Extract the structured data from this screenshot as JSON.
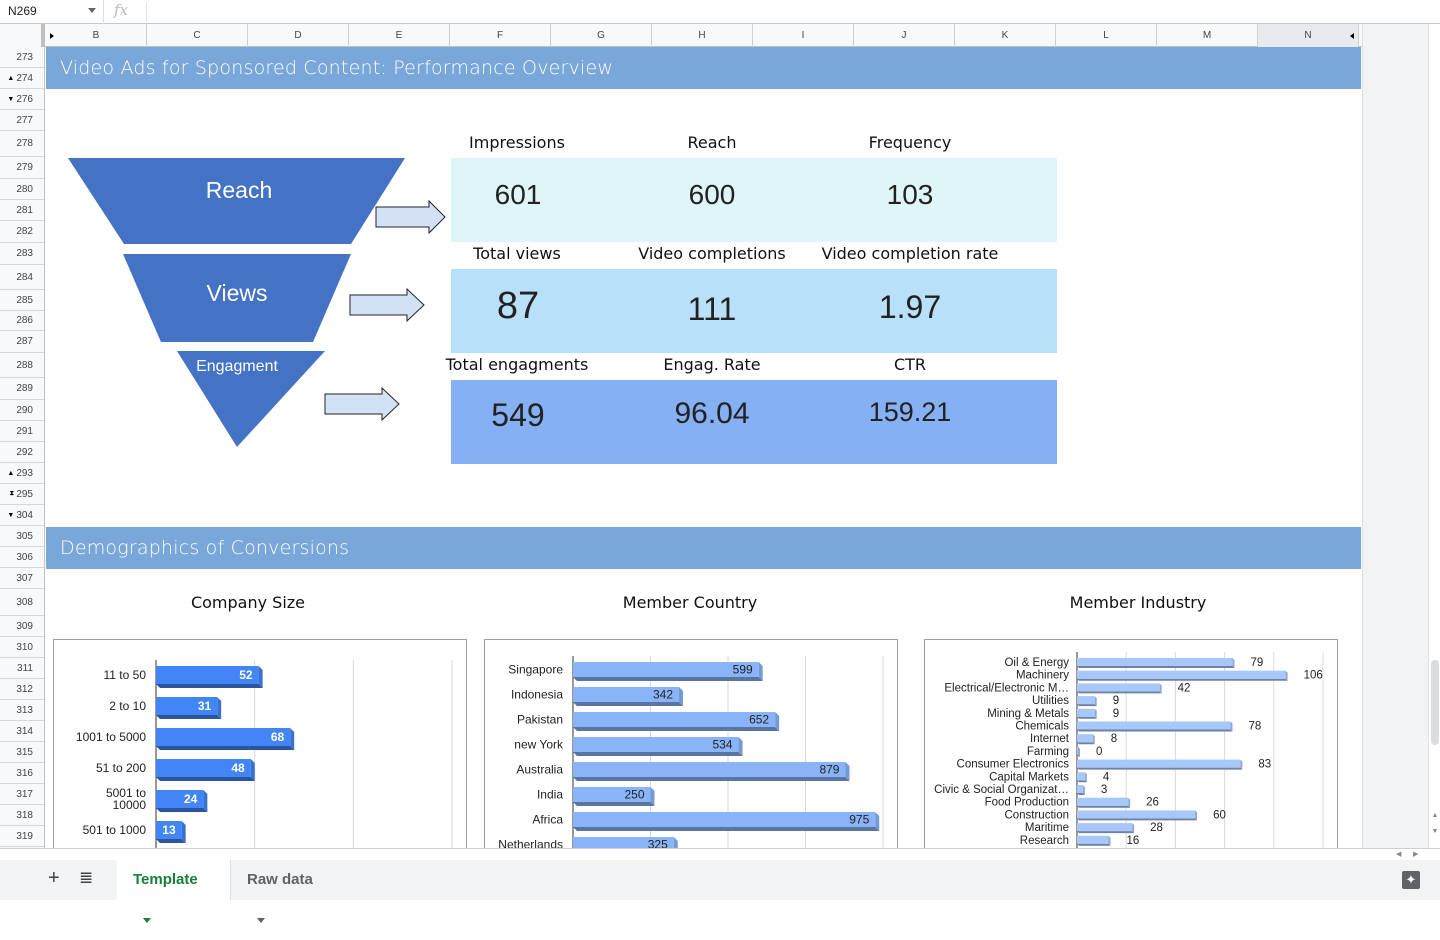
{
  "formula_bar": {
    "cell_ref": "N269",
    "fx_symbol": "fx",
    "formula": ""
  },
  "columns": [
    "B",
    "C",
    "D",
    "E",
    "F",
    "G",
    "H",
    "I",
    "J",
    "K",
    "L",
    "M",
    "N"
  ],
  "rows": [
    {
      "label": "273",
      "marker": ""
    },
    {
      "label": "274",
      "marker": "▲"
    },
    {
      "label": "276",
      "marker": "▼"
    },
    {
      "label": "277",
      "marker": ""
    },
    {
      "label": "278",
      "marker": ""
    },
    {
      "label": "279",
      "marker": ""
    },
    {
      "label": "280",
      "marker": ""
    },
    {
      "label": "281",
      "marker": ""
    },
    {
      "label": "282",
      "marker": ""
    },
    {
      "label": "283",
      "marker": ""
    },
    {
      "label": "284",
      "marker": ""
    },
    {
      "label": "285",
      "marker": ""
    },
    {
      "label": "286",
      "marker": ""
    },
    {
      "label": "287",
      "marker": ""
    },
    {
      "label": "288",
      "marker": ""
    },
    {
      "label": "289",
      "marker": ""
    },
    {
      "label": "290",
      "marker": ""
    },
    {
      "label": "291",
      "marker": ""
    },
    {
      "label": "292",
      "marker": ""
    },
    {
      "label": "293",
      "marker": "▲"
    },
    {
      "label": "295",
      "marker": "⧗"
    },
    {
      "label": "304",
      "marker": "▼"
    },
    {
      "label": "305",
      "marker": ""
    },
    {
      "label": "306",
      "marker": ""
    },
    {
      "label": "307",
      "marker": ""
    },
    {
      "label": "308",
      "marker": ""
    },
    {
      "label": "309",
      "marker": ""
    },
    {
      "label": "310",
      "marker": ""
    },
    {
      "label": "311",
      "marker": ""
    },
    {
      "label": "312",
      "marker": ""
    },
    {
      "label": "313",
      "marker": ""
    },
    {
      "label": "314",
      "marker": ""
    },
    {
      "label": "315",
      "marker": ""
    },
    {
      "label": "316",
      "marker": ""
    },
    {
      "label": "317",
      "marker": ""
    },
    {
      "label": "318",
      "marker": ""
    },
    {
      "label": "319",
      "marker": ""
    }
  ],
  "sections": {
    "performance_title": "Video Ads for Sponsored Content: Performance Overview",
    "demographics_title": "Demographics of Conversions"
  },
  "funnel": {
    "stages": [
      "Reach",
      "Views",
      "Engagment"
    ],
    "color": "#4472c4"
  },
  "metrics": [
    {
      "band_color": "#dff5f8",
      "items": [
        {
          "label": "Impressions",
          "value": "601"
        },
        {
          "label": "Reach",
          "value": "600"
        },
        {
          "label": "Frequency",
          "value": "103"
        }
      ]
    },
    {
      "band_color": "#b8e0f9",
      "items": [
        {
          "label": "Total views",
          "value": "87"
        },
        {
          "label": "Video completions",
          "value": "111"
        },
        {
          "label": "Video completion rate",
          "value": "1.97"
        }
      ]
    },
    {
      "band_color": "#86b0f4",
      "items": [
        {
          "label": "Total engagments",
          "value": "549"
        },
        {
          "label": "Engag. Rate",
          "value": "96.04"
        },
        {
          "label": "CTR",
          "value": "159.21"
        }
      ]
    }
  ],
  "chart_data": [
    {
      "type": "bar",
      "title": "Company Size",
      "orientation": "horizontal",
      "bar_color": "#4285f4",
      "label_color": "#ffffff",
      "categories": [
        "11 to 50",
        "2 to 10",
        "1001 to 5000",
        "51 to 200",
        "5001 to 10000",
        "501 to 1000"
      ],
      "values": [
        52,
        31,
        68,
        48,
        24,
        13
      ],
      "xlim": [
        0,
        150
      ],
      "grid": true,
      "truncated_note": "more categories below visible area"
    },
    {
      "type": "bar",
      "title": "Member Country",
      "orientation": "horizontal",
      "bar_color": "#8ab4f8",
      "label_color": "#222222",
      "categories": [
        "Singapore",
        "Indonesia",
        "Pakistan",
        "new York",
        "Australia",
        "India",
        "Africa",
        "Netherlands"
      ],
      "values": [
        599,
        342,
        652,
        534,
        879,
        250,
        975,
        325
      ],
      "xlim": [
        0,
        1000
      ],
      "grid": true
    },
    {
      "type": "bar",
      "title": "Member Industry",
      "orientation": "horizontal",
      "bar_color": "#a8c7fa",
      "label_color": "#222222",
      "categories": [
        "Oil & Energy",
        "Machinery",
        "Electrical/Electronic M…",
        "Utilities",
        "Mining & Metals",
        "Chemicals",
        "Internet",
        "Farming",
        "Consumer Electronics",
        "Capital Markets",
        "Civic & Social Organizat…",
        "Food Production",
        "Construction",
        "Maritime",
        "Research"
      ],
      "values": [
        79,
        106,
        42,
        9,
        9,
        78,
        8,
        0,
        83,
        4,
        3,
        26,
        60,
        28,
        16
      ],
      "xlim": [
        0,
        125
      ],
      "grid": true
    }
  ],
  "tabs": [
    {
      "label": "Template",
      "active": true
    },
    {
      "label": "Raw data",
      "active": false
    }
  ],
  "bottom_bar": {
    "add_sheet": "+",
    "all_sheets": "≣"
  }
}
